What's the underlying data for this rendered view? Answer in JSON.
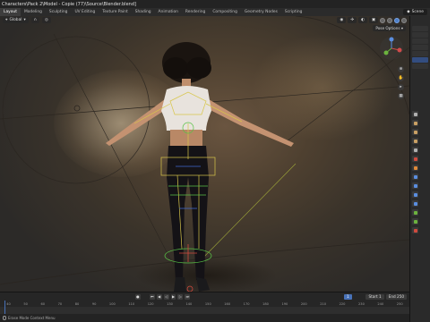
{
  "window": {
    "title": "Characters\\Pack 2\\Model - Copie (77)\\Source\\Blender.blend]"
  },
  "topbar": {
    "workspaces": [
      "Layout",
      "Modeling",
      "Sculpting",
      "UV Editing",
      "Texture Paint",
      "Shading",
      "Animation",
      "Rendering",
      "Compositing",
      "Geometry Nodes",
      "Scripting"
    ],
    "active_workspace": "Layout",
    "scene_label": "Scene"
  },
  "viewport": {
    "transform_orientation": "Global",
    "pose_options_label": "Pose Options",
    "accent_color": "#4d7fc9"
  },
  "timeline": {
    "current_frame": "1",
    "start_label": "Start",
    "start_value": "1",
    "end_label": "End",
    "end_value": "250",
    "ruler_ticks": [
      "40",
      "50",
      "60",
      "70",
      "80",
      "90",
      "100",
      "110",
      "120",
      "130",
      "140",
      "150",
      "160",
      "170",
      "180",
      "190",
      "200",
      "210",
      "220",
      "230",
      "240",
      "250"
    ],
    "play_controls": [
      "jump-start-icon",
      "step-back-icon",
      "play-reverse-icon",
      "play-icon",
      "step-forward-icon",
      "jump-end-icon"
    ],
    "play_glyphs": [
      "⏮",
      "◀",
      "◁",
      "▶",
      "▷",
      "⏭"
    ]
  },
  "statusbar": {
    "hint": "Erase Mode Context Menu"
  }
}
